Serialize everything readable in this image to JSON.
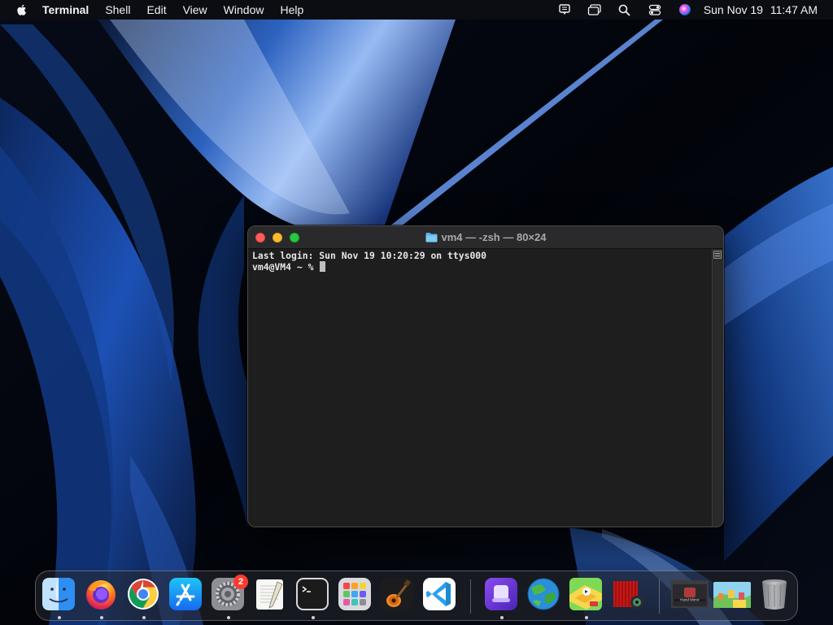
{
  "menubar": {
    "app_name": "Terminal",
    "menus": [
      "Shell",
      "Edit",
      "View",
      "Window",
      "Help"
    ],
    "status_icons": [
      "wifi-icon",
      "screen-mirroring-icon",
      "spotlight-search-icon",
      "control-center-icon",
      "siri-icon"
    ],
    "date": "Sun Nov 19",
    "time": "11:47 AM"
  },
  "terminal": {
    "title": "vm4 — -zsh — 80×24",
    "lines": [
      "Last login: Sun Nov 19 10:20:29 on ttys000",
      "vm4@VM4 ~ % "
    ]
  },
  "dock": {
    "apps": [
      {
        "name": "finder-icon",
        "running": true
      },
      {
        "name": "firefox-icon",
        "running": true
      },
      {
        "name": "chrome-icon",
        "running": true
      },
      {
        "name": "app-store-icon",
        "running": false
      },
      {
        "name": "system-settings-icon",
        "running": true,
        "badge": "2"
      },
      {
        "name": "textedit-icon",
        "running": false
      },
      {
        "name": "terminal-icon",
        "running": true
      },
      {
        "name": "launchpad-icon",
        "running": false
      },
      {
        "name": "garageband-icon",
        "running": false
      },
      {
        "name": "vscode-icon",
        "running": false
      }
    ],
    "extras": [
      {
        "name": "podcast-capsule-icon",
        "running": true
      },
      {
        "name": "world-globe-game-icon",
        "running": false
      },
      {
        "name": "road-game-icon",
        "running": true
      },
      {
        "name": "photo-booth-icon",
        "running": false
      }
    ],
    "stacks": [
      {
        "name": "hand-mirror-window-icon",
        "label": "Hand Mirror"
      },
      {
        "name": "game-thumbnail-icon"
      },
      {
        "name": "trash-icon"
      }
    ]
  },
  "colors": {
    "terminal_bg": "#1e1e1e",
    "close": "#ff5f57",
    "minimize": "#febc2e",
    "zoom": "#28c840"
  }
}
